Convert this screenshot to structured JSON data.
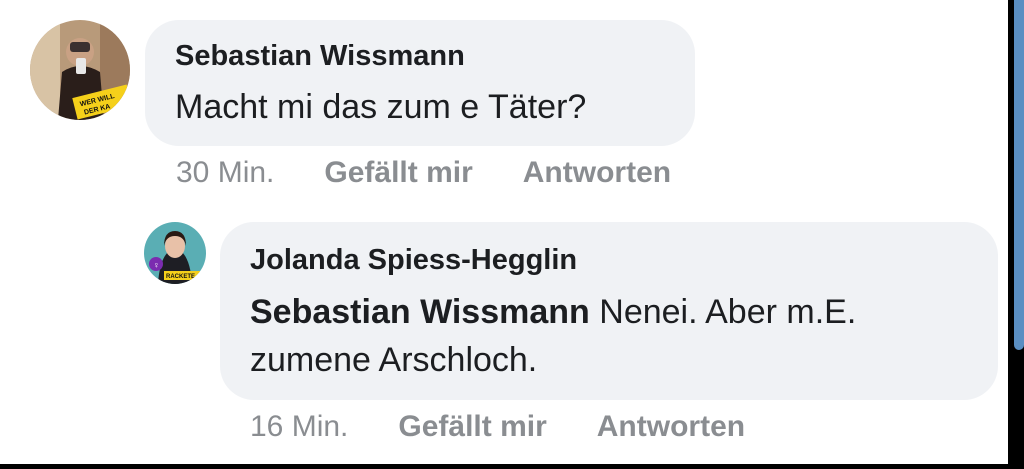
{
  "comments": [
    {
      "author": "Sebastian Wissmann",
      "text": "Macht mi das zum e Täter?",
      "time": "30 Min.",
      "like_label": "Gefällt mir",
      "reply_label": "Antworten",
      "avatar_icon": "profile-photo-icon",
      "avatar_badge": [
        "WER WILL",
        "DER KA"
      ]
    },
    {
      "author": "Jolanda Spiess-Hegglin",
      "mention": "Sebastian Wissmann",
      "text_line1": " Nenei. Aber m.E.",
      "text_line2": "zumene Arschloch.",
      "time": "16 Min.",
      "like_label": "Gefällt mir",
      "reply_label": "Antworten",
      "avatar_icon": "profile-photo-icon",
      "avatar_badge": "RACKETE"
    }
  ],
  "colors": {
    "bubble": "#f0f2f5",
    "text": "#1c1e21",
    "meta": "#8a8d91"
  }
}
